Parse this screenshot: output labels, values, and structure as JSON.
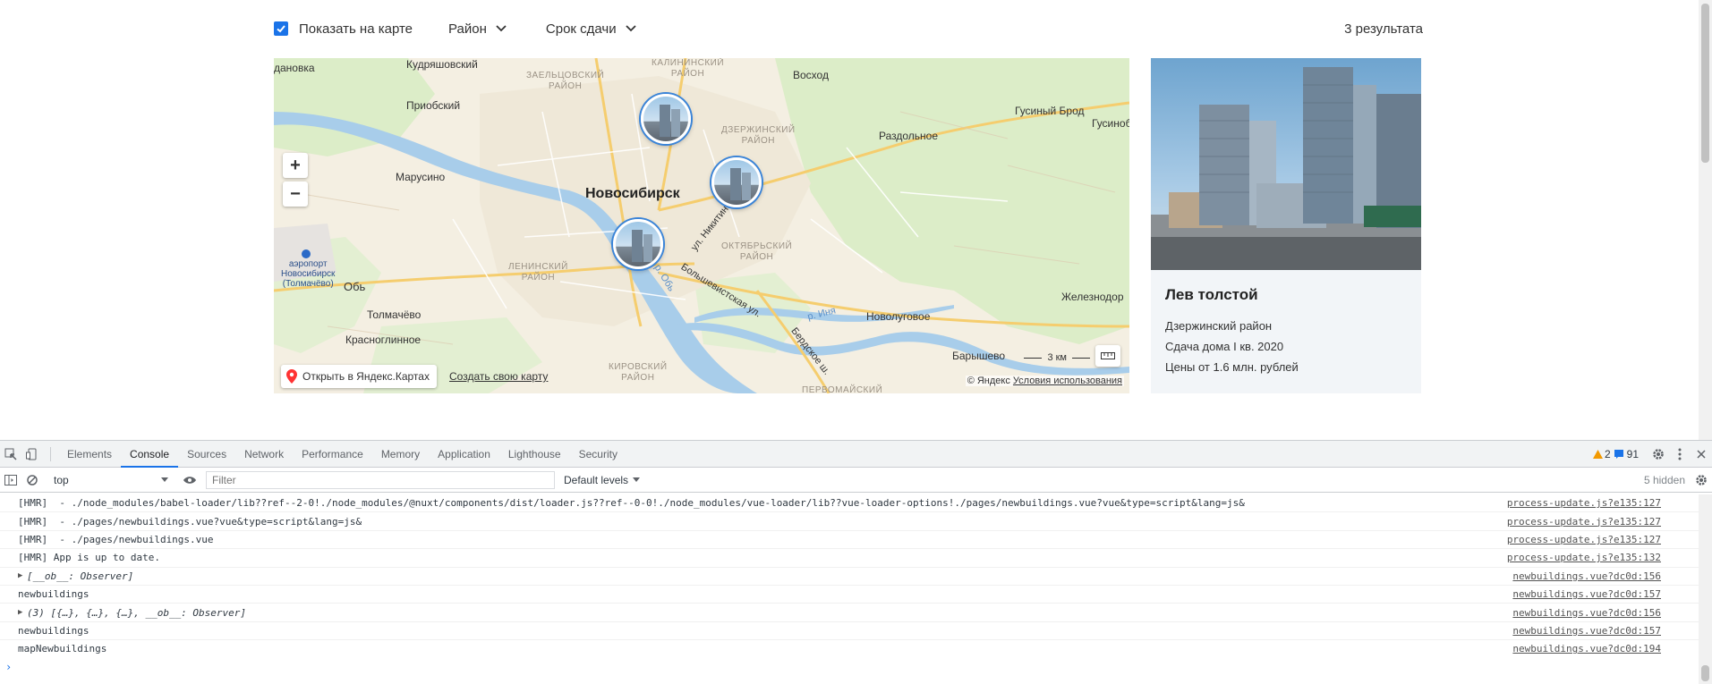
{
  "filters": {
    "show_on_map": "Показать на карте",
    "district": "Район",
    "deadline": "Срок сдачи",
    "results": "3 результата"
  },
  "map": {
    "labels": {
      "kudryashovsky": "Кудряшовский",
      "zaeltsovsky": "ЗАЕЛЬЦОВСКИЙ\nРАЙОН",
      "kalininsky": "КАЛИНИНСКИЙ\nРАЙОН",
      "voskhod": "Восход",
      "prioosky": "Приобский",
      "dzerzhinsky": "ДЗЕРЖИНСКИЙ\nРАЙОН",
      "gusiny_brod": "Гусиный Брод",
      "gusinob": "Гусиноб",
      "razdolnoe": "Раздольное",
      "marusino": "Марусино",
      "novosibirsk": "Новосибирск",
      "ul_nikitina": "ул. Никитина",
      "oktyabrsky": "ОКТЯБРЬСКИЙ\nРАЙОН",
      "airport": "аэропорт\nНовосибирск\n(Толмачёво)",
      "leninsky": "ЛЕНИНСКИЙ\nРАЙОН",
      "ob_river": "р. Обь",
      "bolshevistskaya": "Большевистская ул.",
      "ob": "Обь",
      "zheleznodor": "Железнодор",
      "tolmachevo": "Толмачёво",
      "inya": "р. Иня",
      "novolugovoe": "Новолуговое",
      "krasnoglinnoe": "Красноглинное",
      "berdskoe": "Бердское ш.",
      "kirovsky": "КИРОВСКИЙ\nРАЙОН",
      "baryshevo": "Барышево",
      "pervomaysky": "ПЕРВОМАЙСКИЙ",
      "danovka": "дановка"
    },
    "zoom_in": "+",
    "zoom_out": "−",
    "open_yandex": "Открыть в Яндекс.Картах",
    "create_map": "Создать свою карту",
    "copyright_prefix": "© Яндекс",
    "terms": "Условия использования",
    "scale": "3 км"
  },
  "card": {
    "title": "Лев толстой",
    "district": "Дзержинский район",
    "delivery": "Сдача дома I кв. 2020",
    "price": "Цены от 1.6 млн. рублей"
  },
  "devtools": {
    "tabs": [
      "Elements",
      "Console",
      "Sources",
      "Network",
      "Performance",
      "Memory",
      "Application",
      "Lighthouse",
      "Security"
    ],
    "warnings": "2",
    "messages": "91",
    "context": "top",
    "filter_placeholder": "Filter",
    "levels": "Default levels",
    "hidden": "5 hidden",
    "rows": [
      {
        "msg": "[HMR]  - ./node_modules/babel-loader/lib??ref--2-0!./node_modules/@nuxt/components/dist/loader.js??ref--0-0!./node_modules/vue-loader/lib??vue-loader-options!./pages/newbuildings.vue?vue&type=script&lang=js&",
        "src": "process-update.js?e135:127"
      },
      {
        "msg": "[HMR]  - ./pages/newbuildings.vue?vue&type=script&lang=js&",
        "src": "process-update.js?e135:127"
      },
      {
        "msg": "[HMR]  - ./pages/newbuildings.vue",
        "src": "process-update.js?e135:127"
      },
      {
        "msg": "[HMR] App is up to date.",
        "src": "process-update.js?e135:132"
      },
      {
        "msg": "[__ob__: Observer]",
        "src": "newbuildings.vue?dc0d:156",
        "expandable": true
      },
      {
        "msg": "newbuildings",
        "src": "newbuildings.vue?dc0d:157"
      },
      {
        "msg": "(3) [{…}, {…}, {…}, __ob__: Observer]",
        "src": "newbuildings.vue?dc0d:156",
        "expandable": true
      },
      {
        "msg": "newbuildings",
        "src": "newbuildings.vue?dc0d:157"
      },
      {
        "msg": "mapNewbuildings",
        "src": "newbuildings.vue?dc0d:194"
      }
    ],
    "prompt": "›"
  },
  "colors": {
    "accent": "#1a73e8",
    "water": "#a8cdea",
    "park": "#d6ecbe"
  }
}
